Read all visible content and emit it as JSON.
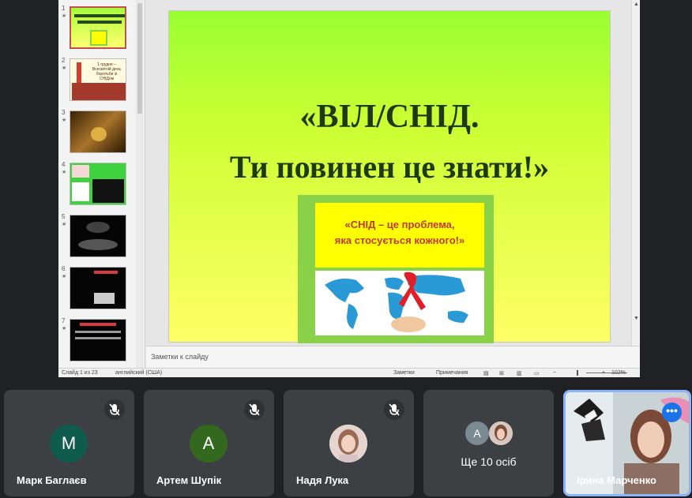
{
  "presentation": {
    "thumbnails": [
      {
        "num": "1",
        "star": "★"
      },
      {
        "num": "2",
        "star": "★"
      },
      {
        "num": "3",
        "star": "★"
      },
      {
        "num": "4",
        "star": "★"
      },
      {
        "num": "5",
        "star": "★"
      },
      {
        "num": "6",
        "star": "★"
      },
      {
        "num": "7",
        "star": "★"
      }
    ],
    "thumb2_text": "1 грудня – Всесвітній день боротьби зі СНІДом",
    "slide": {
      "title_line1": "«ВІЛ/СНІД.",
      "title_line2": "Ти повинен це знати!»",
      "poster_line1": "«СНІД – це проблема,",
      "poster_line2": "яка стосується кожного!»"
    },
    "notes_placeholder": "Заметки к слайду",
    "status": {
      "slide_counter": "Слайд 1 из 23",
      "language": "английский (США)",
      "notes_btn": "Заметки",
      "comments_btn": "Примечания",
      "zoom_minus": "−",
      "zoom_plus": "+",
      "zoom": "102%"
    }
  },
  "participants": [
    {
      "name": "Марк Баглаєв",
      "initial": "M",
      "avatar_color": "#0f5b4d"
    },
    {
      "name": "Артем Шупік",
      "initial": "A",
      "avatar_color": "#33691e"
    },
    {
      "name": "Надя Лука"
    }
  ],
  "more": {
    "initial": "A",
    "label": "Ще 10 осіб"
  },
  "self": {
    "name": "Ірина Марченко",
    "menu": "•••"
  },
  "colors": {
    "meet_bg": "#202124",
    "tile_bg": "#3c4043",
    "highlight": "#8ab4f8",
    "button_blue": "#1a73e8"
  }
}
